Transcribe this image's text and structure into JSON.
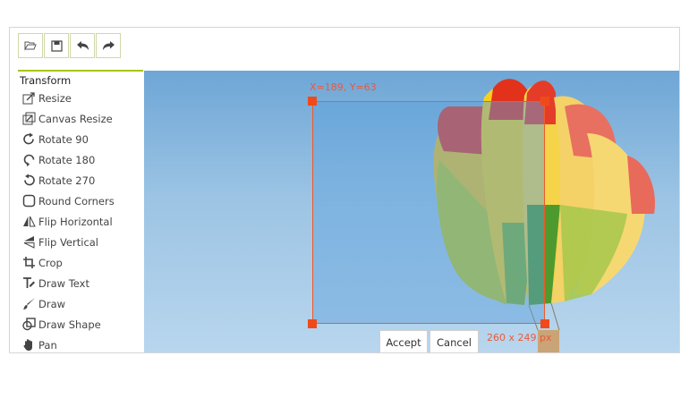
{
  "toolbar": {
    "buttons": [
      {
        "name": "open-icon"
      },
      {
        "name": "save-icon"
      },
      {
        "name": "undo-icon"
      },
      {
        "name": "redo-icon"
      }
    ]
  },
  "sidebar": {
    "title": "Transform",
    "items": [
      {
        "label": "Resize",
        "icon": "resize-icon"
      },
      {
        "label": "Canvas Resize",
        "icon": "canvas-resize-icon"
      },
      {
        "label": "Rotate 90",
        "icon": "rotate-90-icon"
      },
      {
        "label": "Rotate 180",
        "icon": "rotate-180-icon"
      },
      {
        "label": "Rotate 270",
        "icon": "rotate-270-icon"
      },
      {
        "label": "Round Corners",
        "icon": "round-corners-icon"
      },
      {
        "label": "Flip Horizontal",
        "icon": "flip-horizontal-icon"
      },
      {
        "label": "Flip Vertical",
        "icon": "flip-vertical-icon"
      },
      {
        "label": "Crop",
        "icon": "crop-icon"
      },
      {
        "label": "Draw Text",
        "icon": "draw-text-icon"
      },
      {
        "label": "Draw",
        "icon": "draw-icon"
      },
      {
        "label": "Draw Shape",
        "icon": "draw-shape-icon"
      },
      {
        "label": "Pan",
        "icon": "pan-icon"
      }
    ]
  },
  "crop": {
    "position_label": "X=189, Y=63",
    "size_label": "260 x 249 px"
  },
  "actions": {
    "accept": "Accept",
    "cancel": "Cancel"
  },
  "colors": {
    "accent": "#a6c516",
    "crop": "#f05a28",
    "sky": "#9cc4e4"
  }
}
